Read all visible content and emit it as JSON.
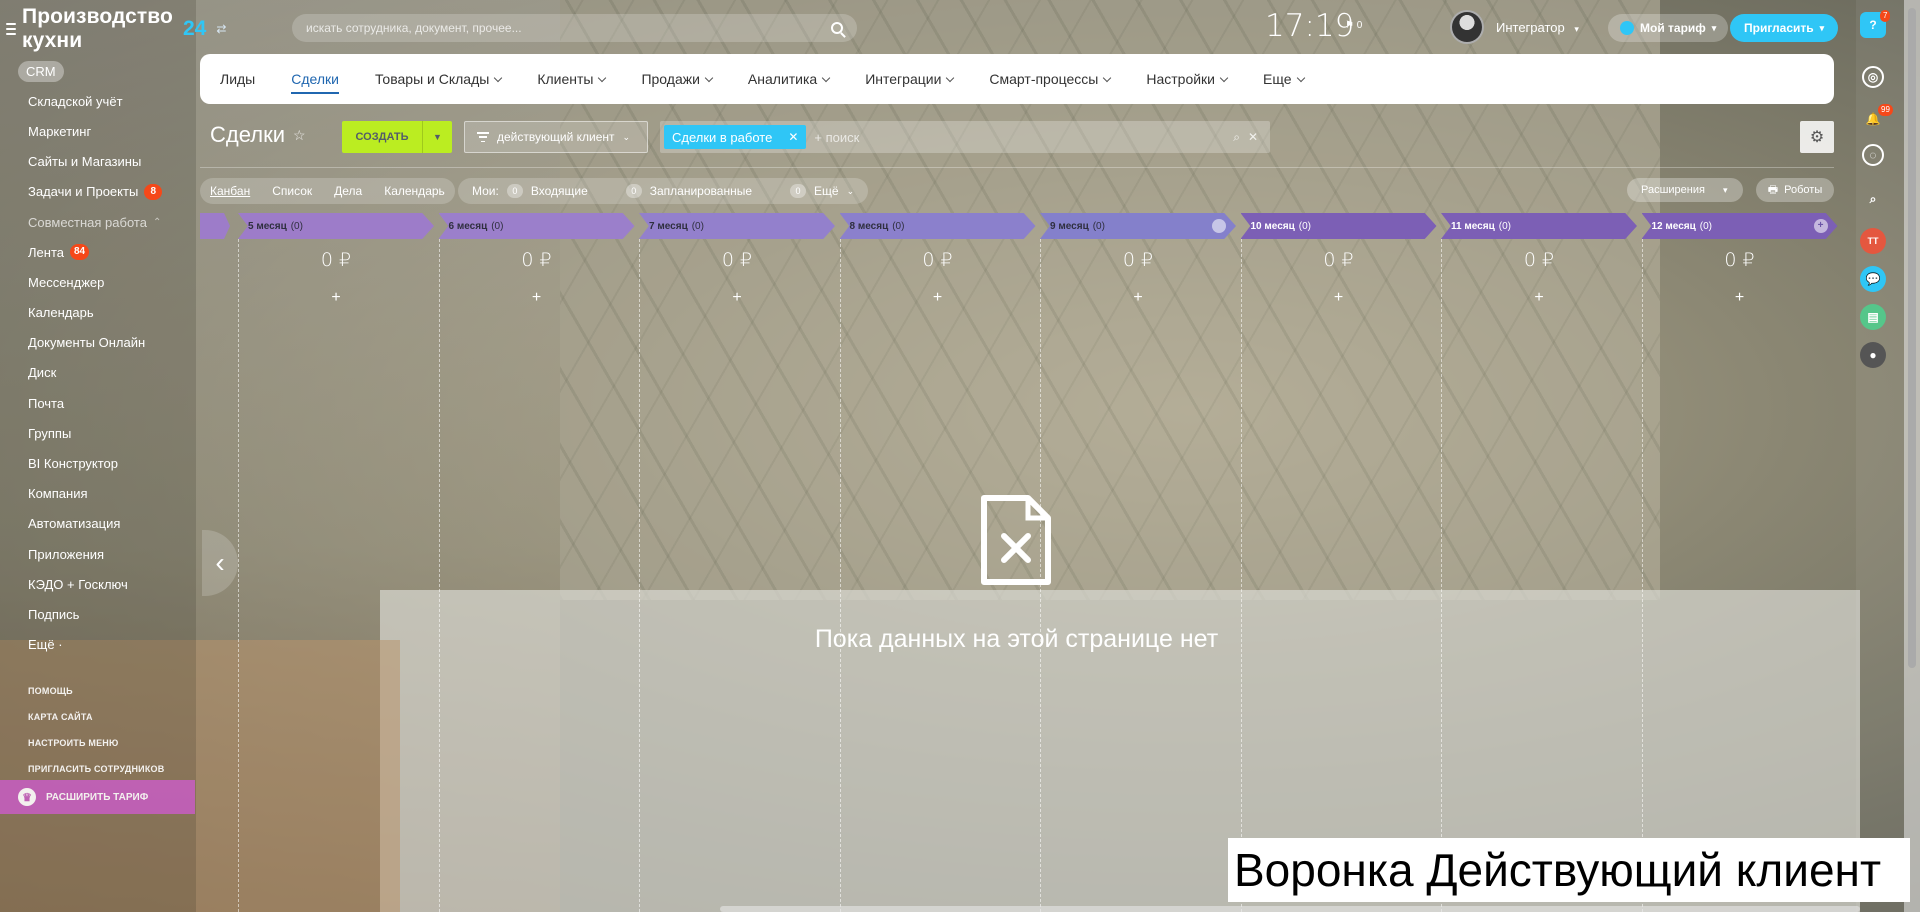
{
  "app": {
    "title": "Производство кухни",
    "title_suffix": "24",
    "swap_glyph": "⇄"
  },
  "header": {
    "search_placeholder": "искать сотрудника, документ, прочее...",
    "clock": "17:19",
    "flag_count": "⚑ 0",
    "user_name": "Интегратор",
    "tariff_label": "Мой тариф",
    "invite_label": "Пригласить"
  },
  "sidebar": {
    "items": [
      {
        "label": "CRM",
        "active": true
      },
      {
        "label": "Складской учёт"
      },
      {
        "label": "Маркетинг"
      },
      {
        "label": "Сайты и Магазины"
      },
      {
        "label": "Задачи и Проекты",
        "counter": "8"
      },
      {
        "label": "Совместная работа",
        "muted": true
      },
      {
        "label": "Лента",
        "counter": "84"
      },
      {
        "label": "Мессенджер"
      },
      {
        "label": "Календарь"
      },
      {
        "label": "Документы Онлайн"
      },
      {
        "label": "Диск"
      },
      {
        "label": "Почта"
      },
      {
        "label": "Группы"
      },
      {
        "label": "BI Конструктор"
      },
      {
        "label": "Компания"
      },
      {
        "label": "Автоматизация"
      },
      {
        "label": "Приложения"
      },
      {
        "label": "КЭДО + Госключ"
      },
      {
        "label": "Подпись"
      },
      {
        "label": "Ещё ·"
      }
    ],
    "links": [
      "ПОМОЩЬ",
      "КАРТА САЙТА",
      "НАСТРОИТЬ МЕНЮ",
      "ПРИГЛАСИТЬ СОТРУДНИКОВ"
    ],
    "expand_tariff": "РАСШИРИТЬ ТАРИФ"
  },
  "nav": {
    "tabs": [
      {
        "label": "Лиды"
      },
      {
        "label": "Сделки",
        "active": true
      },
      {
        "label": "Товары и Склады",
        "dropdown": true
      },
      {
        "label": "Клиенты",
        "dropdown": true
      },
      {
        "label": "Продажи",
        "dropdown": true
      },
      {
        "label": "Аналитика",
        "dropdown": true
      },
      {
        "label": "Интеграции",
        "dropdown": true
      },
      {
        "label": "Смарт-процессы",
        "dropdown": true
      },
      {
        "label": "Настройки",
        "dropdown": true
      },
      {
        "label": "Еще",
        "dropdown": true
      }
    ]
  },
  "toolbar": {
    "page_title": "Сделки",
    "create_label": "СОЗДАТЬ",
    "funnel_label": "действующий клиент",
    "filter_chip": "Сделки в работе",
    "filter_placeholder": "+ поиск"
  },
  "views": {
    "items": [
      "Канбан",
      "Список",
      "Дела",
      "Календарь"
    ],
    "mine_label": "Мои:",
    "incoming_count": "0",
    "incoming_label": "Входящие",
    "planned_count": "0",
    "planned_label": "Запланированные",
    "more_count": "0",
    "more_label": "Ещё",
    "extensions_label": "Расширения",
    "robots_label": "Роботы"
  },
  "kanban": {
    "stages": [
      {
        "name": "5 месяц",
        "count": "(0)",
        "sum": "0 ₽",
        "color": "#9d7cc9",
        "text_color": "#2f2f3f"
      },
      {
        "name": "6 месяц",
        "count": "(0)",
        "sum": "0 ₽",
        "color": "#9b7fcb",
        "text_color": "#2f2f3f"
      },
      {
        "name": "7 месяц",
        "count": "(0)",
        "sum": "0 ₽",
        "color": "#9380cc",
        "text_color": "#2f2f3f"
      },
      {
        "name": "8 месяц",
        "count": "(0)",
        "sum": "0 ₽",
        "color": "#8b80cc",
        "text_color": "#2f2f3f"
      },
      {
        "name": "9 месяц",
        "count": "(0)",
        "sum": "0 ₽",
        "color": "#8480cb",
        "text_color": "#2f2f3f"
      },
      {
        "name": "10 месяц",
        "count": "(0)",
        "sum": "0 ₽",
        "color": "#7c5fb5",
        "text_color": "#ffffff"
      },
      {
        "name": "11 месяц",
        "count": "(0)",
        "sum": "0 ₽",
        "color": "#7c5fb5",
        "text_color": "#ffffff"
      },
      {
        "name": "12 месяц",
        "count": "(0)",
        "sum": "0 ₽",
        "color": "#7c5fb5",
        "text_color": "#ffffff"
      }
    ],
    "empty_text": "Пока данных на этой странице нет"
  },
  "rail": {
    "help_badge": "7",
    "notif_badge": "99",
    "avatar_initials": "ТТ"
  },
  "caption": "Воронка Действующий клиент"
}
